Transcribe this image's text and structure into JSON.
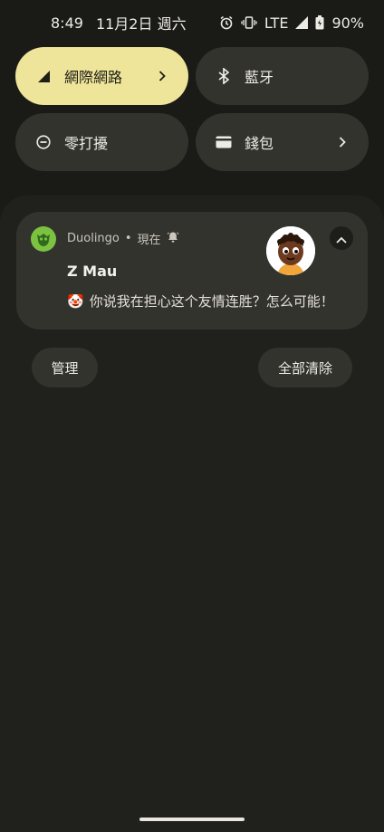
{
  "status_bar": {
    "time": "8:49",
    "date": "11月2日 週六",
    "network": "LTE",
    "battery": "90%"
  },
  "quick_settings": {
    "internet": {
      "label": "網際網路",
      "active": true
    },
    "bluetooth": {
      "label": "藍牙",
      "active": false
    },
    "dnd": {
      "label": "零打擾",
      "active": false
    },
    "wallet": {
      "label": "錢包",
      "active": false
    }
  },
  "notification": {
    "app_name": "Duolingo",
    "separator": "•",
    "time": "現在",
    "title": "Z Mau",
    "emoji": "🤡",
    "message": "你说我在担心这个友情连胜？怎么可能！"
  },
  "actions": {
    "manage": "管理",
    "clear_all": "全部清除"
  },
  "colors": {
    "accent_tile": "#efe59a",
    "tile_bg": "#33332d",
    "background": "#1a1a17",
    "duolingo_green": "#7cc242"
  }
}
